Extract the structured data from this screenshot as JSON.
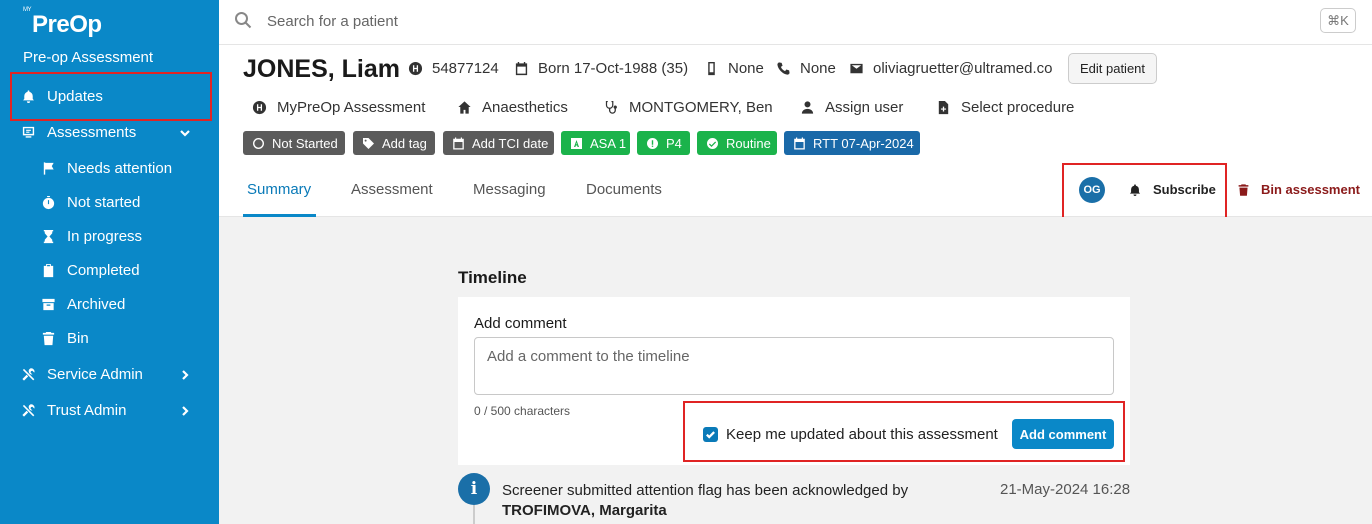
{
  "sidebar": {
    "logo": "PreOp",
    "logo_sup": "MY",
    "subtitle": "Pre-op Assessment",
    "items": [
      {
        "label": "Updates"
      },
      {
        "label": "Assessments"
      },
      {
        "label": "Needs attention"
      },
      {
        "label": "Not started"
      },
      {
        "label": "In progress"
      },
      {
        "label": "Completed"
      },
      {
        "label": "Archived"
      },
      {
        "label": "Bin"
      },
      {
        "label": "Service Admin"
      },
      {
        "label": "Trust Admin"
      }
    ]
  },
  "search": {
    "placeholder": "Search for a patient",
    "shortcut": "⌘K"
  },
  "patient": {
    "name": "JONES, Liam",
    "hospital_number": "54877124",
    "born": "Born 17-Oct-1988 (35)",
    "mobile": "None",
    "phone": "None",
    "email": "oliviagruetter@ultramed.co",
    "edit_label": "Edit patient",
    "assessment": "MyPreOp Assessment",
    "department": "Anaesthetics",
    "clinician": "MONTGOMERY, Ben",
    "assign_user": "Assign user",
    "select_procedure": "Select procedure"
  },
  "tags": [
    {
      "label": "Not Started",
      "color": "#5b5b5b"
    },
    {
      "label": "Add tag",
      "color": "#5b5b5b"
    },
    {
      "label": "Add TCI date",
      "color": "#5b5b5b"
    },
    {
      "label": "ASA 1",
      "color": "#1bb34b"
    },
    {
      "label": "P4",
      "color": "#1bb34b"
    },
    {
      "label": "Routine",
      "color": "#1bb34b"
    },
    {
      "label": "RTT 07-Apr-2024",
      "color": "#1a69a8"
    }
  ],
  "tabs": [
    {
      "label": "Summary",
      "active": true
    },
    {
      "label": "Assessment"
    },
    {
      "label": "Messaging"
    },
    {
      "label": "Documents"
    }
  ],
  "actions": {
    "avatar_initials": "OG",
    "subscribe": "Subscribe",
    "bin": "Bin assessment"
  },
  "timeline": {
    "title": "Timeline",
    "comment_label": "Add comment",
    "comment_placeholder": "Add a comment to the timeline",
    "char_count": "0 / 500 characters",
    "keep_updated": "Keep me updated about this assessment",
    "keep_updated_checked": true,
    "add_button": "Add comment",
    "entries": [
      {
        "text": "Screener submitted attention flag has been acknowledged by",
        "author": "TROFIMOVA, Margarita",
        "time": "21-May-2024 16:28"
      }
    ]
  },
  "colors": {
    "sidebar": "#0a88c8",
    "accent": "#0a7ab8",
    "highlight": "#e02424"
  }
}
